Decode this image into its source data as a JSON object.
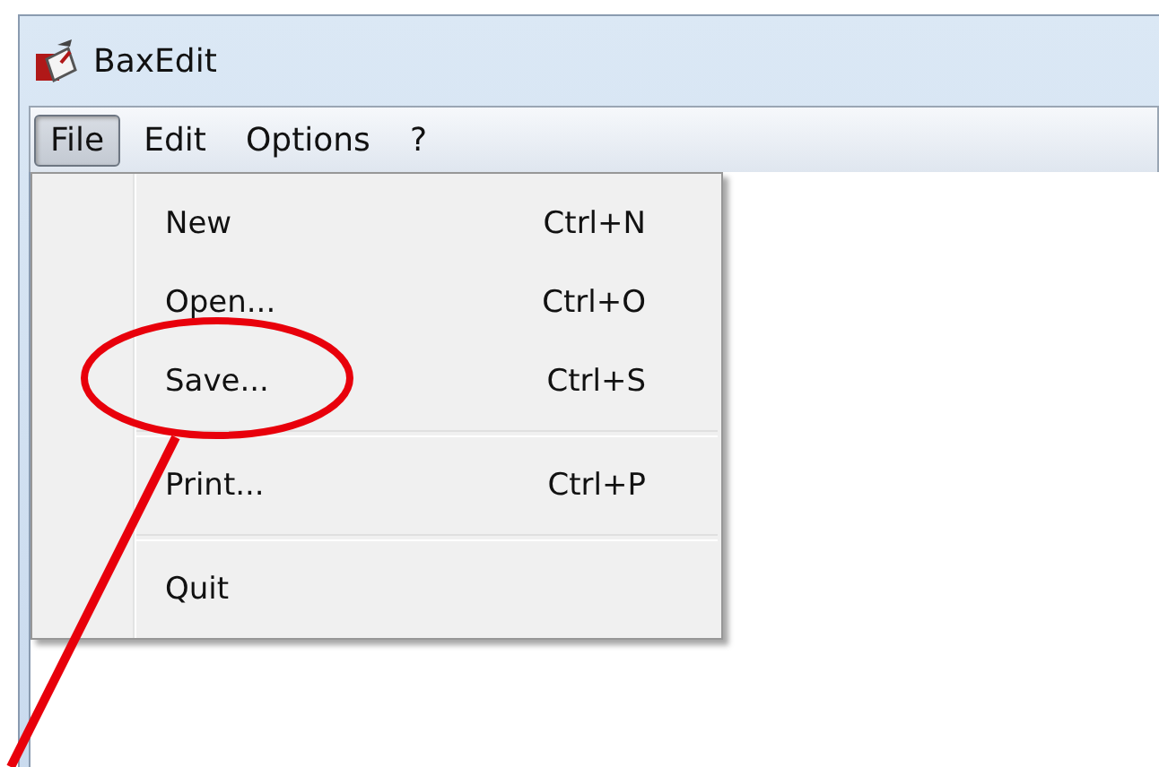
{
  "window": {
    "title": "BaxEdit"
  },
  "menubar": [
    {
      "label": "File",
      "selected": true
    },
    {
      "label": "Edit",
      "selected": false
    },
    {
      "label": "Options",
      "selected": false
    },
    {
      "label": "?",
      "selected": false
    }
  ],
  "file_menu": [
    {
      "kind": "item",
      "label": "New",
      "shortcut": "Ctrl+N",
      "circled": false
    },
    {
      "kind": "item",
      "label": "Open...",
      "shortcut": "Ctrl+O",
      "circled": false
    },
    {
      "kind": "item",
      "label": "Save...",
      "shortcut": "Ctrl+S",
      "circled": true
    },
    {
      "kind": "separator"
    },
    {
      "kind": "item",
      "label": "Print...",
      "shortcut": "Ctrl+P",
      "circled": false
    },
    {
      "kind": "separator"
    },
    {
      "kind": "item",
      "label": "Quit",
      "circled": false
    }
  ]
}
